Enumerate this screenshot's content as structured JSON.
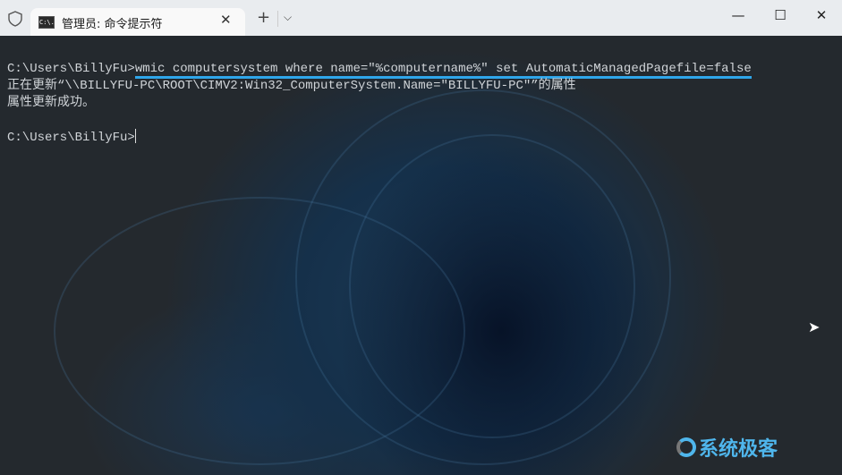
{
  "tab": {
    "title": "管理员: 命令提示符",
    "icon_text": "C:\\.",
    "close": "✕"
  },
  "titlebar": {
    "new_tab": "+",
    "dropdown": "⌵",
    "minimize": "—",
    "maximize": "☐",
    "close": "✕"
  },
  "terminal": {
    "prompt": "C:\\Users\\BillyFu>",
    "command": "wmic computersystem where name=\"%computername%\" set AutomaticManagedPagefile=false",
    "output1": "正在更新“\\\\BILLYFU-PC\\ROOT\\CIMV2:Win32_ComputerSystem.Name=\"BILLYFU-PC\"”的属性",
    "output2": "属性更新成功。",
    "prompt2": "C:\\Users\\BillyFu>"
  },
  "watermark": "系统极客",
  "colors": {
    "accent": "#2fa6ea",
    "logo": "#4fb6ec"
  }
}
